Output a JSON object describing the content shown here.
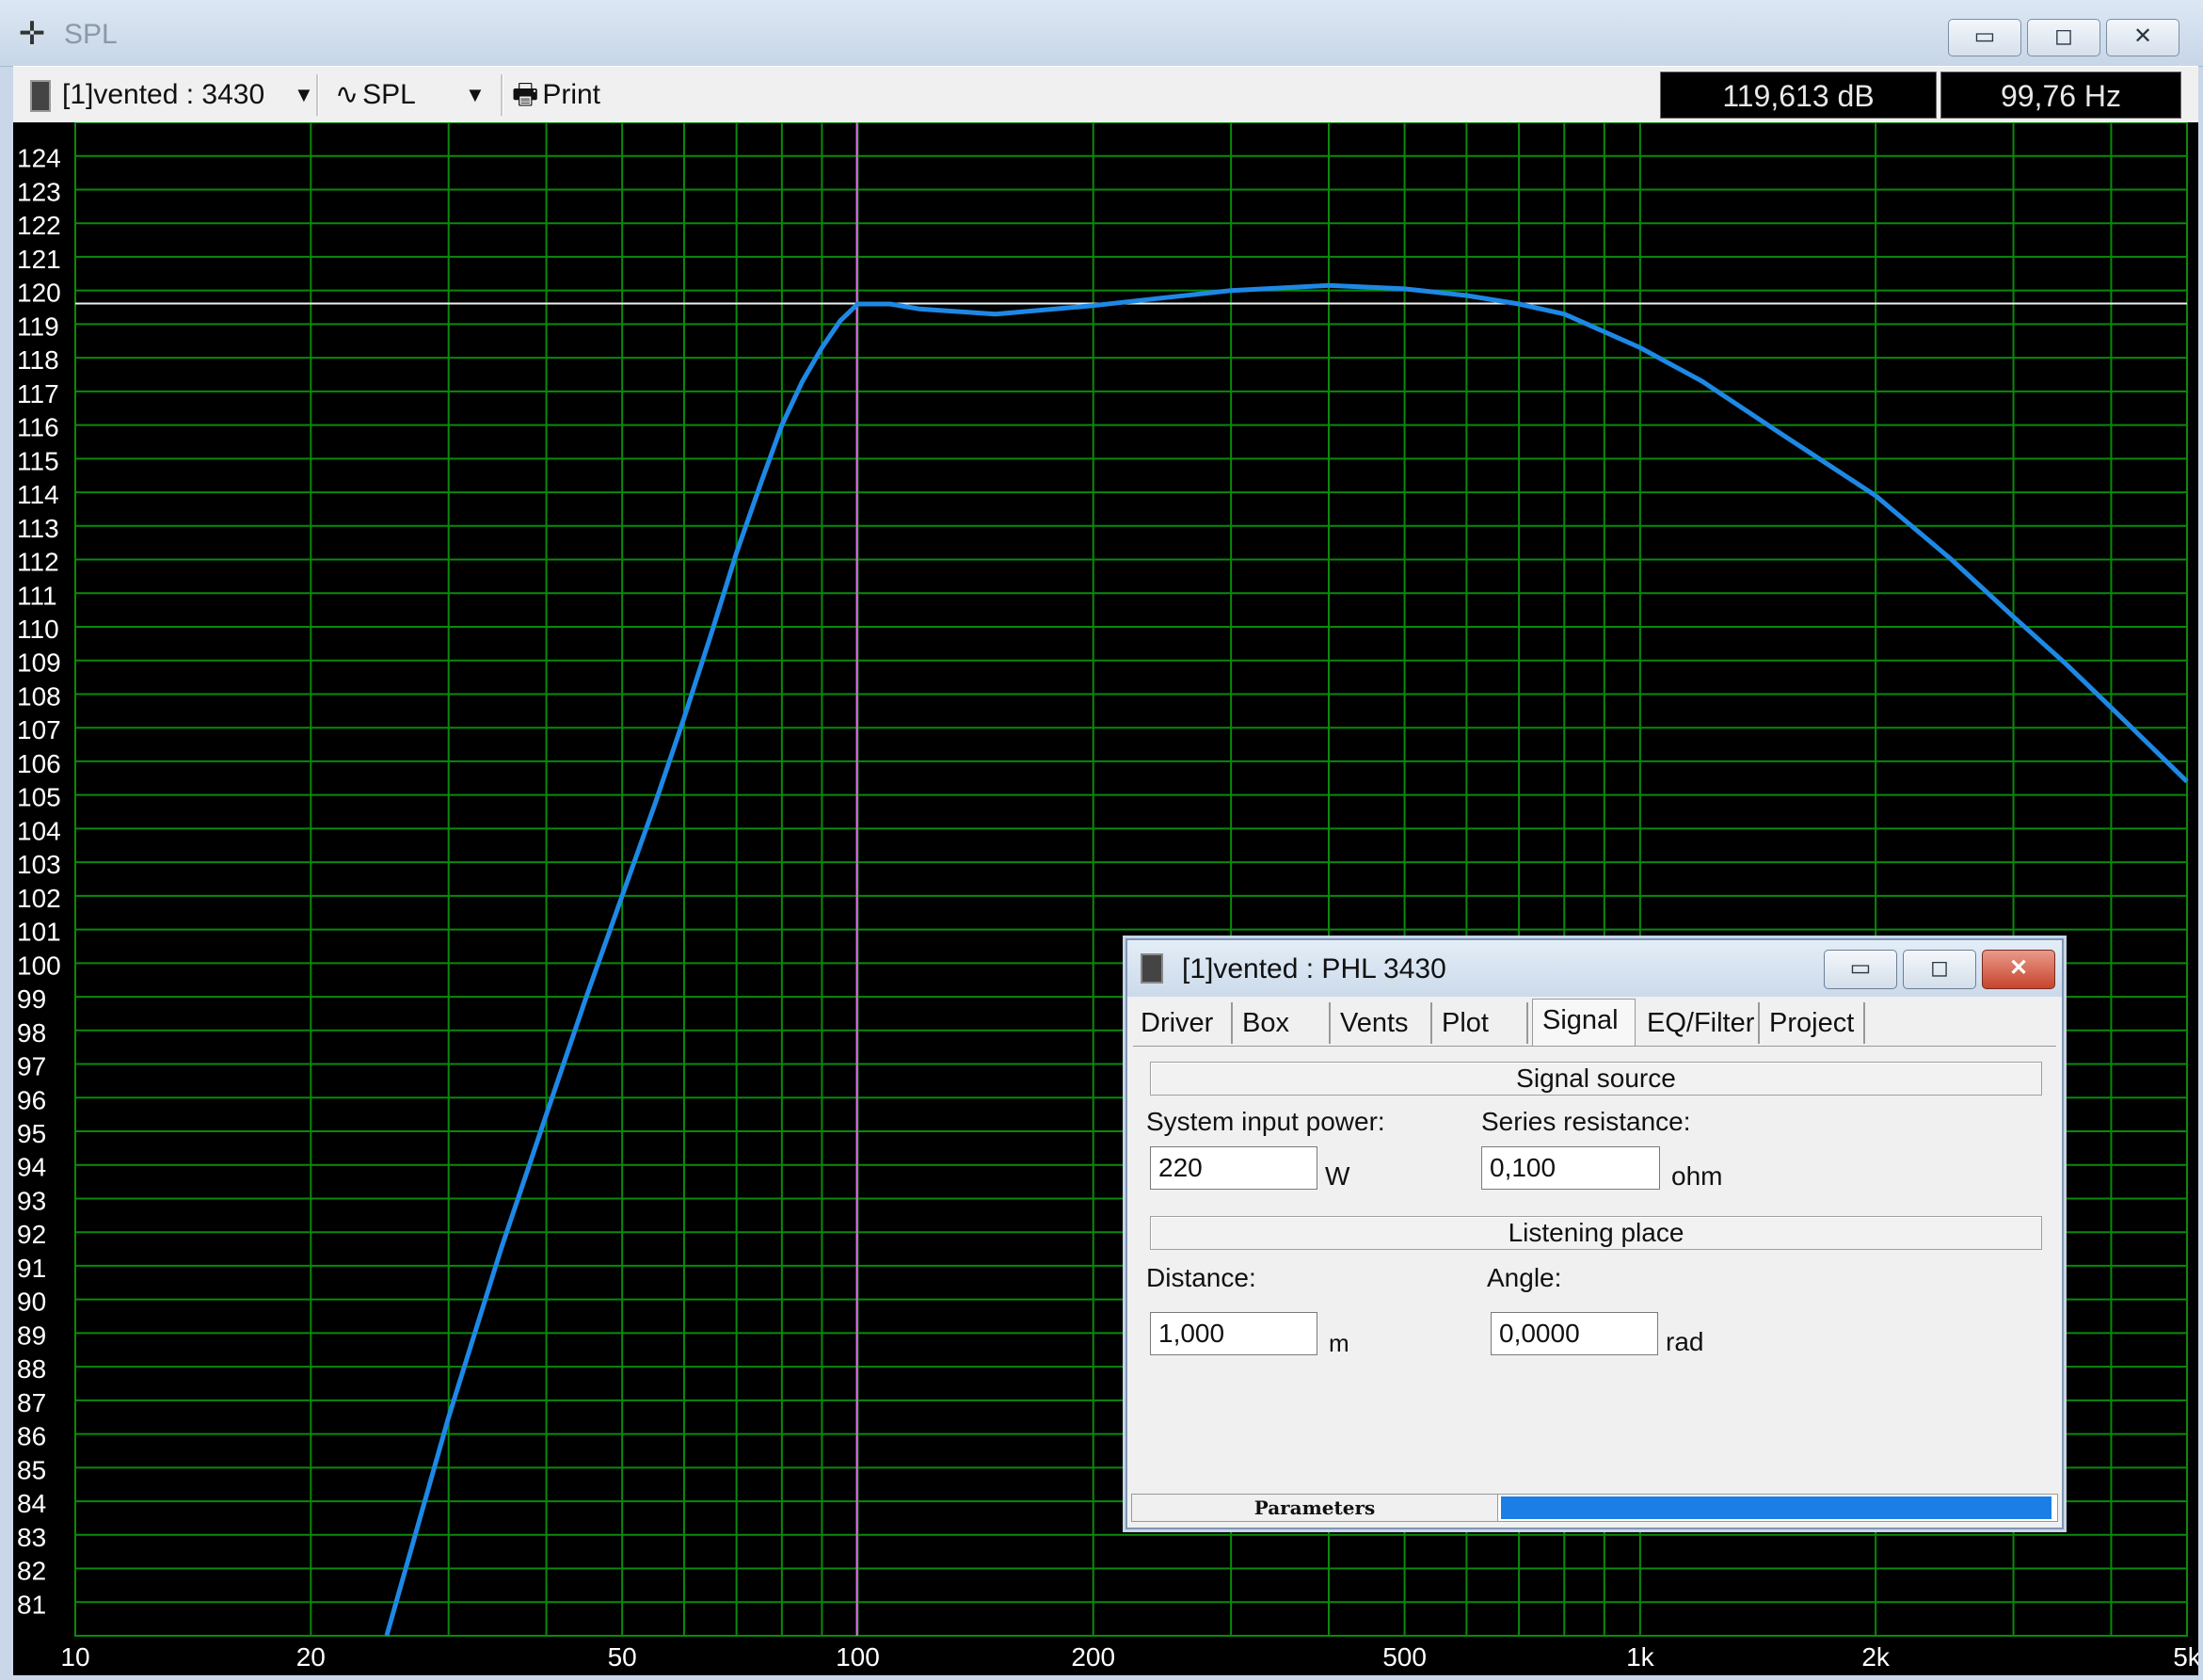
{
  "window": {
    "title": "SPL",
    "app_icon": "crosshair-icon",
    "controls": [
      "minimize-icon",
      "maximize-icon",
      "close-icon"
    ]
  },
  "toolbar": {
    "project_select": "[1]vented : 3430",
    "plot_select": "SPL",
    "print_label": "Print",
    "readout_db": "119,613 dB",
    "readout_hz": "99,76 Hz"
  },
  "chart_data": {
    "type": "line",
    "title": "",
    "xlabel": "",
    "ylabel": "",
    "xscale": "log",
    "xlim": [
      10,
      5000
    ],
    "ylim": [
      80,
      125
    ],
    "x_tick_labels": [
      {
        "value": 10,
        "label": "10"
      },
      {
        "value": 20,
        "label": "20"
      },
      {
        "value": 50,
        "label": "50"
      },
      {
        "value": 100,
        "label": "100"
      },
      {
        "value": 200,
        "label": "200"
      },
      {
        "value": 500,
        "label": "500"
      },
      {
        "value": 1000,
        "label": "1k"
      },
      {
        "value": 2000,
        "label": "2k"
      },
      {
        "value": 5000,
        "label": "5k"
      }
    ],
    "y_ticks": [
      81,
      82,
      83,
      84,
      85,
      86,
      87,
      88,
      89,
      90,
      91,
      92,
      93,
      94,
      95,
      96,
      97,
      98,
      99,
      100,
      101,
      102,
      103,
      104,
      105,
      106,
      107,
      108,
      109,
      110,
      111,
      112,
      113,
      114,
      115,
      116,
      117,
      118,
      119,
      120,
      121,
      122,
      123,
      124
    ],
    "grid": true,
    "cursor": {
      "x": 99.76,
      "y": 119.613
    },
    "series": [
      {
        "color": "#1e88e5",
        "points": [
          [
            25,
            80
          ],
          [
            30,
            86.5
          ],
          [
            35,
            91.5
          ],
          [
            40,
            95.5
          ],
          [
            45,
            99
          ],
          [
            50,
            102
          ],
          [
            55,
            104.7
          ],
          [
            60,
            107.3
          ],
          [
            65,
            109.8
          ],
          [
            70,
            112.2
          ],
          [
            75,
            114.2
          ],
          [
            80,
            116
          ],
          [
            85,
            117.3
          ],
          [
            90,
            118.3
          ],
          [
            95,
            119.1
          ],
          [
            100,
            119.6
          ],
          [
            110,
            119.6
          ],
          [
            120,
            119.45
          ],
          [
            150,
            119.3
          ],
          [
            200,
            119.55
          ],
          [
            250,
            119.8
          ],
          [
            300,
            120.0
          ],
          [
            400,
            120.15
          ],
          [
            500,
            120.05
          ],
          [
            600,
            119.85
          ],
          [
            700,
            119.6
          ],
          [
            800,
            119.3
          ],
          [
            1000,
            118.3
          ],
          [
            1200,
            117.3
          ],
          [
            1500,
            115.8
          ],
          [
            2000,
            113.9
          ],
          [
            2500,
            112.0
          ],
          [
            3000,
            110.3
          ],
          [
            3500,
            108.9
          ],
          [
            4000,
            107.6
          ],
          [
            5000,
            105.4
          ]
        ]
      }
    ]
  },
  "dialog": {
    "title": "[1]vented : PHL 3430",
    "tabs": [
      "Driver",
      "Box",
      "Vents",
      "Plot",
      "Signal",
      "EQ/Filter",
      "Project"
    ],
    "active_tab": "Signal",
    "signal_source": {
      "heading": "Signal source",
      "power_label": "System input power:",
      "power_value": "220",
      "power_unit": "W",
      "res_label": "Series resistance:",
      "res_value": "0,100",
      "res_unit": "ohm"
    },
    "listening_place": {
      "heading": "Listening place",
      "distance_label": "Distance:",
      "distance_value": "1,000",
      "distance_unit": "m",
      "angle_label": "Angle:",
      "angle_value": "0,0000",
      "angle_unit": "rad"
    },
    "status": {
      "label": "Parameters",
      "progress": 1.0
    }
  }
}
